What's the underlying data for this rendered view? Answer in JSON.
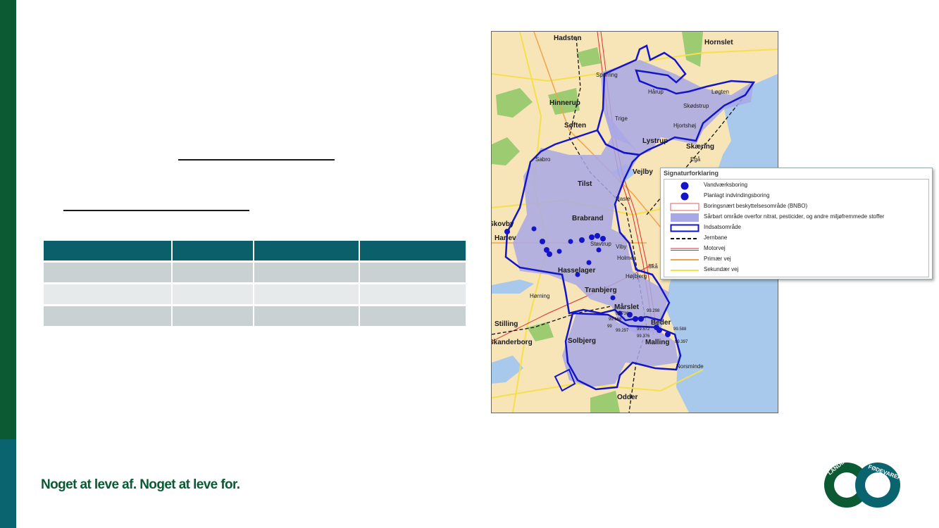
{
  "slogan": "Noget at leve af. Noget at leve for.",
  "map": {
    "towns": [
      {
        "id": "hadsten",
        "label": "Hadsten"
      },
      {
        "id": "hornslet",
        "label": "Hornslet"
      },
      {
        "id": "sporring",
        "label": "Spørring"
      },
      {
        "id": "harup",
        "label": "Hårup"
      },
      {
        "id": "logten",
        "label": "Løgten"
      },
      {
        "id": "hinnerup",
        "label": "Hinnerup"
      },
      {
        "id": "skodstrup",
        "label": "Skødstrup"
      },
      {
        "id": "trige",
        "label": "Trige"
      },
      {
        "id": "hjortshoj",
        "label": "Hjortshøj"
      },
      {
        "id": "softem",
        "label": "Søften"
      },
      {
        "id": "lystrup",
        "label": "Lystrup"
      },
      {
        "id": "skaering",
        "label": "Skæring"
      },
      {
        "id": "ega",
        "label": "Egå"
      },
      {
        "id": "sabro",
        "label": "Sabro"
      },
      {
        "id": "vejlby",
        "label": "Vejlby"
      },
      {
        "id": "tilst",
        "label": "Tilst"
      },
      {
        "id": "hasle",
        "label": "Hasle"
      },
      {
        "id": "brabrand",
        "label": "Brabrand"
      },
      {
        "id": "skovby",
        "label": "Skovby"
      },
      {
        "id": "harlev",
        "label": "Harlev"
      },
      {
        "id": "stavtrup",
        "label": "Stavtrup"
      },
      {
        "id": "viby",
        "label": "Viby"
      },
      {
        "id": "holme",
        "label": "Holme"
      },
      {
        "id": "hasselager",
        "label": "Hasselager"
      },
      {
        "id": "hojbjerg",
        "label": "Højbjerg"
      },
      {
        "id": "ska",
        "label": "Skå"
      },
      {
        "id": "horning",
        "label": "Hørning"
      },
      {
        "id": "tranbjerg",
        "label": "Tranbjerg"
      },
      {
        "id": "marslet",
        "label": "Mårslet"
      },
      {
        "id": "stilling",
        "label": "Stilling"
      },
      {
        "id": "beder",
        "label": "Beder"
      },
      {
        "id": "skanderborg",
        "label": "Skanderborg"
      },
      {
        "id": "solbjerg",
        "label": "Solbjerg"
      },
      {
        "id": "malling",
        "label": "Malling"
      },
      {
        "id": "norsminde",
        "label": "Norsminde"
      },
      {
        "id": "odder",
        "label": "Odder"
      }
    ],
    "well_numbers": [
      "99.298",
      "99.736",
      "99.668",
      "99.297",
      "99.572",
      "99.588",
      "99.376",
      "99.397",
      "99"
    ]
  },
  "legend": {
    "title": "Signaturforklaring",
    "items": [
      {
        "label": "Vandværksboring",
        "symbol": "well-dot"
      },
      {
        "label": "Planlagt indvindingsboring",
        "symbol": "well-dot"
      },
      {
        "label": "Boringsnært beskyttelsesområde (BNBO)",
        "symbol": "bnbo-box"
      },
      {
        "label": "Sårbart område overfor nitrat, pesticider, og andre miljøfremmede stoffer",
        "symbol": "vulnerable-fill"
      },
      {
        "label": "Indsatsområde",
        "symbol": "action-area-box"
      },
      {
        "label": "Jernbane",
        "symbol": "railway-line"
      },
      {
        "label": "Motorvej",
        "symbol": "motorway-line"
      },
      {
        "label": "Primær vej",
        "symbol": "primary-road-line"
      },
      {
        "label": "Sekundær vej",
        "symbol": "secondary-road-line"
      }
    ]
  },
  "logo": {
    "text_left": "LANDBRUG",
    "text_right": "FØDEVARER"
  },
  "colors": {
    "green": "#0b5a34",
    "teal": "#0a6470",
    "table_header": "#0a5f6b",
    "map_blue": "#1414c8",
    "area_fill": "#a8a8e6"
  }
}
